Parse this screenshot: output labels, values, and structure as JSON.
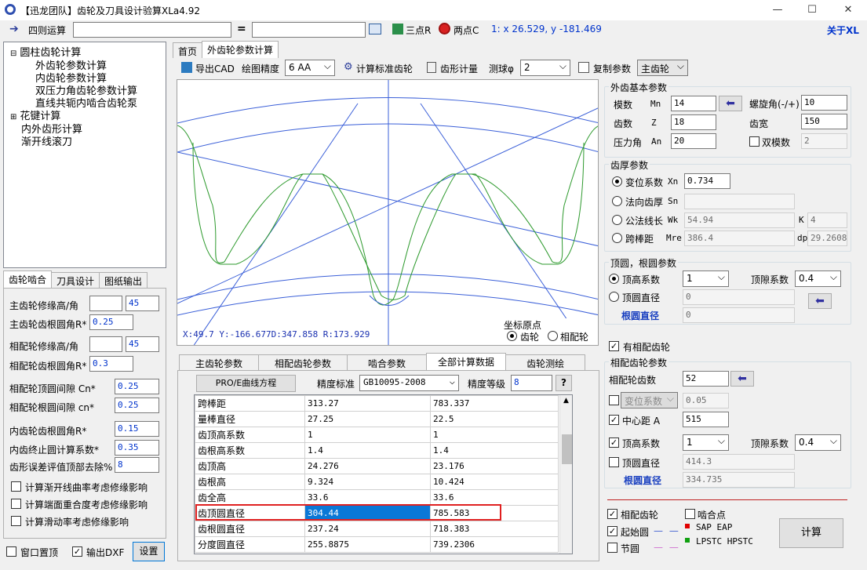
{
  "window": {
    "title": "【迅龙团队】齿轮及刀具设计验算XLa4.92",
    "minimize": "—",
    "maximize": "☐",
    "close": "✕"
  },
  "toolbar": {
    "calc_label": "四则运算",
    "equals": "=",
    "three_point": "三点R",
    "two_point": "两点C",
    "coords": "1: x 26.529, y -181.469",
    "about": "关于XL"
  },
  "tree": {
    "items": [
      {
        "label": "圆柱齿轮计算",
        "toggle": "⊟",
        "level": 0
      },
      {
        "label": "外齿轮参数计算",
        "level": 1
      },
      {
        "label": "内齿轮参数计算",
        "level": 1
      },
      {
        "label": "双压力角齿轮参数计算",
        "level": 1
      },
      {
        "label": "直线共轭内啮合齿轮泵",
        "level": 1
      },
      {
        "label": "花键计算",
        "toggle": "⊞",
        "level": 0
      },
      {
        "label": "内外齿形计算",
        "level": 0
      },
      {
        "label": "渐开线滚刀",
        "level": 0
      }
    ]
  },
  "left_tabs": [
    "齿轮啮合",
    "刀具设计",
    "图纸输出"
  ],
  "left_panel": {
    "rows": [
      {
        "label": "主齿轮修缘高/角",
        "v1": "",
        "v2": "45"
      },
      {
        "label": "主齿轮齿根圆角R*",
        "v1": "0.25"
      },
      {
        "label": "相配轮修缘高/角",
        "v1": "",
        "v2": "45"
      },
      {
        "label": "相配轮齿根圆角R*",
        "v1": "0.3"
      },
      {
        "label": "相配轮顶圆间隙  Cn*",
        "v1": "0.25"
      },
      {
        "label": "相配轮根圆间隙  cn*",
        "v1": "0.25"
      },
      {
        "label": "内齿轮齿根圆角R*",
        "v1": "0.15"
      },
      {
        "label": "内齿终止圆计算系数*",
        "v1": "0.35"
      },
      {
        "label": "齿形误差评值顶部去除%",
        "v1": "8"
      }
    ],
    "checks": [
      "计算渐开线曲率考虑修缘影响",
      "计算端面重合度考虑修缘影响",
      "计算滑动率考虑修缘影响"
    ],
    "win_top": "窗口置顶",
    "output_dxf": "输出DXF",
    "settings": "设置"
  },
  "main_tabs": [
    "首页",
    "外齿轮参数计算"
  ],
  "toolbar2": {
    "export_cad": "导出CAD",
    "precision_label": "绘图精度",
    "precision_value": "6  AA",
    "calc_std": "计算标准齿轮",
    "tooth_measure": "齿形计量",
    "ball_label": "测球φ",
    "ball_value": "2",
    "copy_params": "复制参数",
    "copy_target": "主齿轮"
  },
  "drawing": {
    "status": "X:49.7    Y:-166.677D:347.858 R:173.929",
    "origin_title": "坐标原点",
    "origin_gear": "齿轮",
    "origin_mate": "相配轮"
  },
  "bottom_tabs": [
    "主齿轮参数",
    "相配齿轮参数",
    "啮合参数",
    "全部计算数据",
    "齿轮测绘"
  ],
  "calc_bar": {
    "pro_btn": "PRO/E曲线方程",
    "std_label": "精度标准",
    "std_value": "GB10095-2008",
    "grade_label": "精度等级",
    "grade_value": "8",
    "help": "?"
  },
  "data_table": {
    "rows": [
      [
        "跨棒距",
        "313.27",
        "783.337"
      ],
      [
        "量棒直径",
        "27.25",
        "22.5"
      ],
      [
        "齿顶高系数",
        "1",
        "1"
      ],
      [
        "齿根高系数",
        "1.4",
        "1.4"
      ],
      [
        "齿顶高",
        "24.276",
        "23.176"
      ],
      [
        "齿根高",
        "9.324",
        "10.424"
      ],
      [
        "齿全高",
        "33.6",
        "33.6"
      ],
      [
        "齿顶圆直径",
        "304.44",
        "785.583"
      ],
      [
        "齿根圆直径",
        "237.24",
        "718.383"
      ],
      [
        "分度圆直径",
        "255.8875",
        "739.2306"
      ]
    ],
    "highlight_row": 7
  },
  "right": {
    "basic_title": "外齿基本参数",
    "module_label": "模数",
    "module_sym": "Mn",
    "module_val": "14",
    "helix_label": "螺旋角(-/+)",
    "helix_val": "10",
    "teeth_label": "齿数",
    "teeth_sym": "Z",
    "teeth_val": "18",
    "width_label": "齿宽",
    "width_val": "150",
    "pa_label": "压力角",
    "pa_sym": "An",
    "pa_val": "20",
    "dual_module": "双模数",
    "dual_val": "2",
    "thick_title": "齿厚参数",
    "shift_label": "变位系数",
    "shift_sym": "Xn",
    "shift_val": "0.734",
    "normal_label": "法向齿厚",
    "normal_sym": "Sn",
    "normal_val": "",
    "wk_label": "公法线长",
    "wk_sym": "Wk",
    "wk_val": "54.94",
    "k_sym": "K",
    "k_val": "4",
    "mre_label": "跨棒距",
    "mre_sym": "Mre",
    "mre_val": "386.4",
    "dp_sym": "dp",
    "dp_val": "29.2608",
    "tip_title": "顶圆，根圆参数",
    "addendum_label": "顶高系数",
    "addendum_val": "1",
    "clearance_label": "顶隙系数",
    "clearance_val": "0.4",
    "tip_dia_label": "顶圆直径",
    "tip_dia_val": "0",
    "root_dia_label": "根圆直径",
    "root_dia_val": "0",
    "has_mate": "有相配齿轮",
    "mate_title": "相配齿轮参数",
    "mate_teeth_label": "相配轮齿数",
    "mate_teeth_val": "52",
    "mate_shift_label": "变位系数",
    "mate_shift_val": "0.05",
    "center_label": "中心距  A",
    "center_val": "515",
    "mate_addendum_label": "顶高系数",
    "mate_addendum_val": "1",
    "mate_clearance_label": "顶隙系数",
    "mate_clearance_val": "0.4",
    "mate_tip_label": "顶圆直径",
    "mate_tip_val": "414.3",
    "mate_root_label": "根圆直径",
    "mate_root_val": "334.735",
    "legend_mate": "相配齿轮",
    "legend_mesh": "啮合点",
    "legend_start": "起始圆",
    "legend_sap": "SAP EAP",
    "legend_pitch": "节圆",
    "legend_lpstc": "LPSTC HPSTC",
    "compute": "计算"
  },
  "colors": {
    "gear_green": "#2e9a2e",
    "line_blue": "#3a5fd8",
    "highlight": "#0a78d7",
    "red_box": "#e02020",
    "label_blue": "#1a40c0"
  }
}
